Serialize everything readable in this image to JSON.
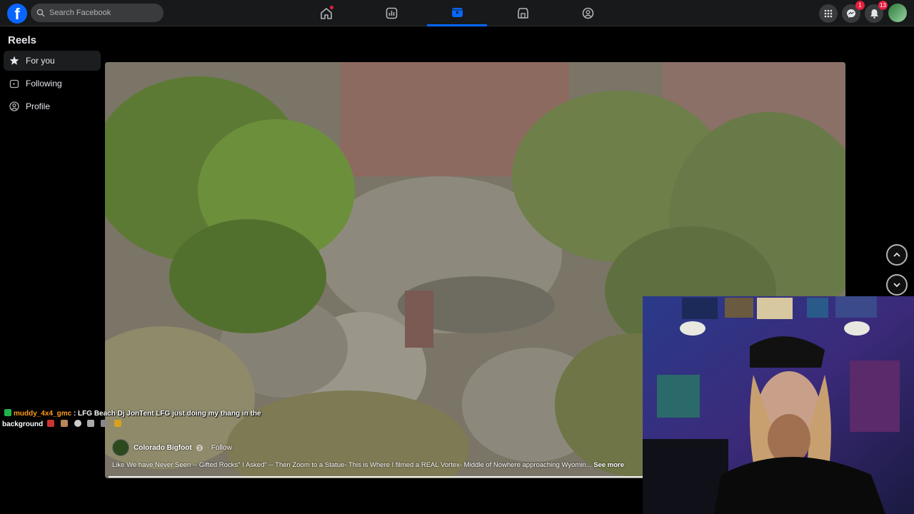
{
  "topbar": {
    "logo_letter": "f",
    "search_placeholder": "Search Facebook",
    "nav": [
      {
        "name": "home-icon",
        "active": false
      },
      {
        "name": "stats-icon",
        "active": false
      },
      {
        "name": "reels-video-icon",
        "active": true
      },
      {
        "name": "marketplace-icon",
        "active": false
      },
      {
        "name": "groups-icon",
        "active": false
      }
    ],
    "messenger_badge": "1",
    "notifications_badge": "13"
  },
  "sidebar": {
    "title": "Reels",
    "items": [
      {
        "label": "For you",
        "icon": "star-icon",
        "active": true
      },
      {
        "label": "Following",
        "icon": "following-icon",
        "active": false
      },
      {
        "label": "Profile",
        "icon": "profile-icon",
        "active": false
      }
    ]
  },
  "chat": {
    "username": "muddy_4x4_gmc",
    "message_line1": ": LFG Beach Dj JonTent LFG just doing my thang in the",
    "message_line2": "background"
  },
  "reel": {
    "author": "Colorado Bigfoot",
    "follow_label": "· Follow",
    "caption": "Like We have Never Seen -- Gifted Rocks\" I Asked\" -- Then Zoom to a Statue- This is Where I filmed a REAL Vortex- Middle of Nowhere approaching Wyomin...",
    "see_more": "See more"
  },
  "colors": {
    "accent": "#0866ff",
    "badge": "#e41e3f",
    "chat_username": "#ff9b1a"
  }
}
